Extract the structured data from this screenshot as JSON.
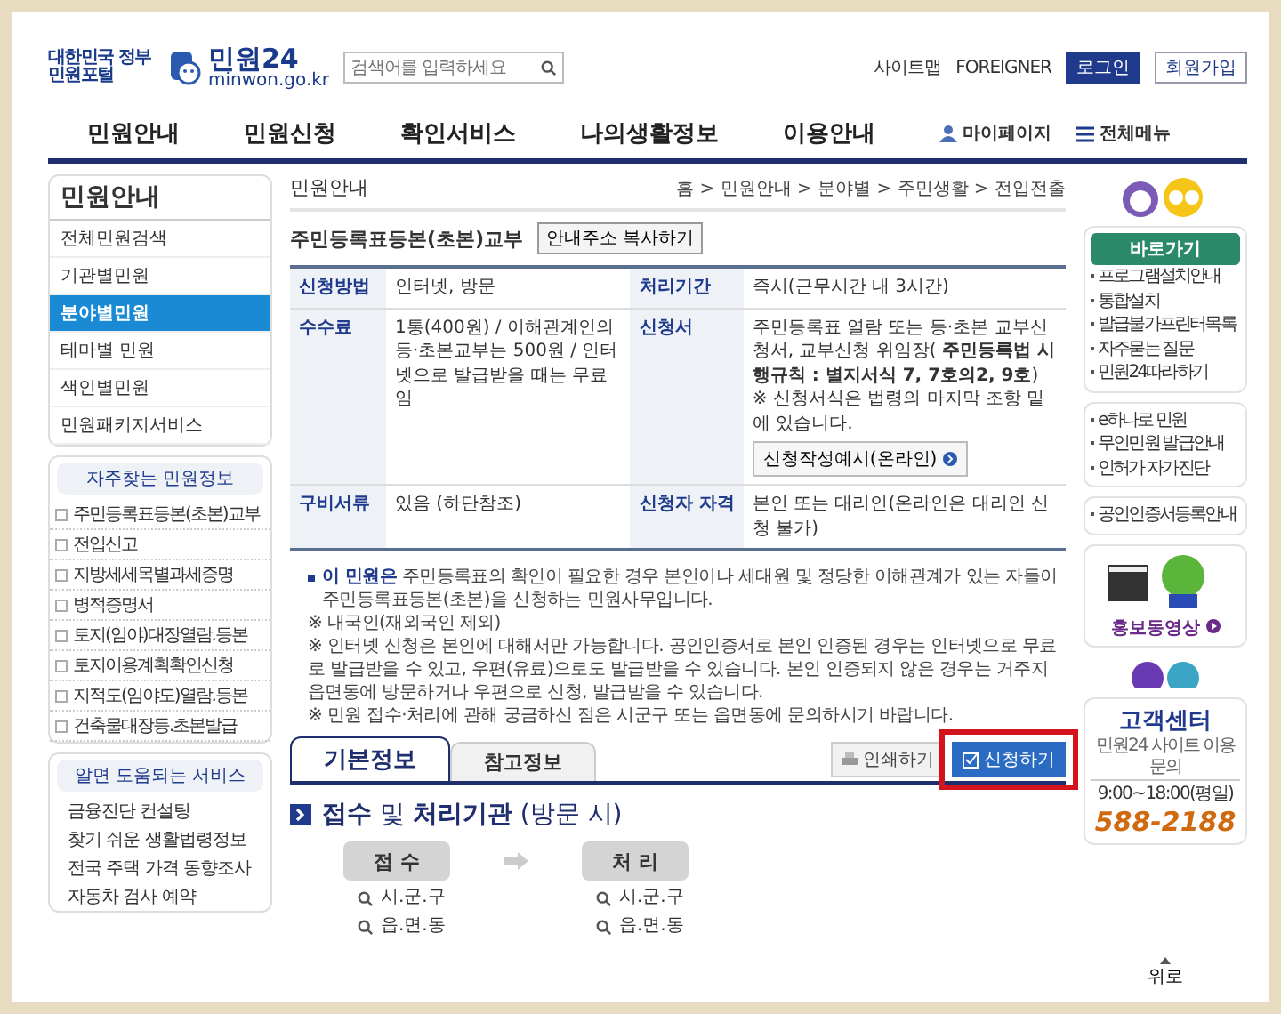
{
  "header": {
    "logo": {
      "tagline": "대한민국 정부민원포털",
      "name": "민원24",
      "domain": "minwon.go.kr"
    },
    "search": {
      "placeholder": "검색어를 입력하세요"
    },
    "links": [
      {
        "label": "사이트맵",
        "kind": "link"
      },
      {
        "label": "FOREIGNER",
        "kind": "link"
      },
      {
        "label": "로그인",
        "kind": "primary"
      },
      {
        "label": "회원가입",
        "kind": "outline"
      }
    ]
  },
  "nav": {
    "items": [
      "민원안내",
      "민원신청",
      "확인서비스",
      "나의생활정보",
      "이용안내"
    ],
    "utilities": [
      {
        "label": "마이페이지",
        "kind": "person"
      },
      {
        "label": "전체메뉴",
        "kind": "menu"
      }
    ]
  },
  "sidebar": {
    "title": "민원안내",
    "items": [
      {
        "label": "전체민원검색",
        "selected": false
      },
      {
        "label": "기관별민원",
        "selected": false
      },
      {
        "label": "분야별민원",
        "selected": true
      },
      {
        "label": "테마별 민원",
        "selected": false
      },
      {
        "label": "색인별민원",
        "selected": false
      },
      {
        "label": "민원패키지서비스",
        "selected": false
      }
    ],
    "popular": {
      "title": "자주찾는 민원정보",
      "items": [
        "주민등록표등본(초본)교부",
        "전입신고",
        "지방세세목별과세증명",
        "병적증명서",
        "토지(임야)대장열람.등본",
        "토지이용계획확인신청",
        "지적도(임야도)열람.등본",
        "건축물대장등.초본발급"
      ]
    },
    "services": {
      "title": "알면 도움되는 서비스",
      "items": [
        "금융진단 컨설팅",
        "찾기 쉬운 생활법령정보",
        "전국 주택 가격 동향조사",
        "자동차 검사 예약"
      ]
    }
  },
  "content": {
    "section": "민원안내",
    "breadcrumb": "홈 > 민원안내 > 분야별 > 주민생활 > 전입전출",
    "title": "주민등록표등본(초본)교부",
    "copy_button": "안내주소 복사하기",
    "table": [
      [
        {
          "label": "신청방법",
          "value": "인터넷, 방문"
        },
        {
          "label": "처리기간",
          "value": "즉시(근무시간 내 3시간)"
        }
      ],
      [
        {
          "label": "수수료",
          "value": "1통(400원) / 이해관계인의 등·초본교부는 500원 / 인터넷으로 발급받을 때는 무료임"
        },
        {
          "label": "신청서",
          "value": "주민등록표 열람 또는 등·초본 교부신청서, 교부신청 위임장( **주민등록법 시행규칙 : 별지서식 7, 7호의2, 9호**)",
          "note": "※ 신청서식은 법령의 마지막 조항 밑에 있습니다.",
          "button": "신청작성예시(온라인)"
        }
      ],
      [
        {
          "label": "구비서류",
          "value": "있음 (하단참조)"
        },
        {
          "label": "신청자 자격",
          "value": "본인 또는 대리인(온라인은 대리인 신청 불가)"
        }
      ]
    ],
    "notes": {
      "lead": "**이 민원은** 주민등록표의 확인이 필요한 경우 본인이나 세대원 및 정당한 이해관계가 있는 자들이 주민등록표등본(초본)을 신청하는 민원사무입니다.",
      "remarks": [
        "※ 내국인(재외국인 제외)",
        "※ 인터넷 신청은 본인에 대해서만 가능합니다. 공인인증서로 본인 인증된 경우는 인터넷으로 무료로 발급받을 수 있고, 우편(유료)으로도 발급받을 수 있습니다. 본인 인증되지 않은 경우는 거주지 읍면동에 방문하거나 우편으로 신청, 발급받을 수 있습니다.",
        "※ 민원 접수·처리에 관해 궁금하신 점은 시군구 또는 읍면동에 문의하시기 바랍니다."
      ]
    },
    "tabs": [
      {
        "label": "기본정보",
        "selected": true
      },
      {
        "label": "참고정보",
        "selected": false
      }
    ],
    "actions": [
      {
        "label": "인쇄하기",
        "kind": "print",
        "highlighted": false
      },
      {
        "label": "신청하기",
        "kind": "apply",
        "highlighted": true
      }
    ],
    "agencies": {
      "heading": "**접수** 및 **처리기관** (방문 시)",
      "steps": [
        {
          "label": "접 수",
          "offices": [
            "시.군.구",
            "읍.면.동"
          ]
        },
        {
          "label": "처 리",
          "offices": [
            "시.군.구",
            "읍.면.동"
          ]
        }
      ]
    }
  },
  "right_rail": {
    "quick_title": "바로가기",
    "groups": [
      [
        "프로그램설치안내",
        "통합설치",
        "발급불가프린터목록",
        "자주묻는 질문",
        "민원24따라하기"
      ],
      [
        "e하나로 민원",
        "무인민원 발급안내",
        "인허가 자가진단"
      ],
      [
        "공인인증서등록안내"
      ]
    ],
    "promo_video": "홍보동영상",
    "help_center": {
      "title": "고객센터",
      "subtitle": "민원24 사이트 이용문의",
      "hours": "9:00~18:00(평일)",
      "phone": "588-2188"
    },
    "top_button": "위로"
  }
}
